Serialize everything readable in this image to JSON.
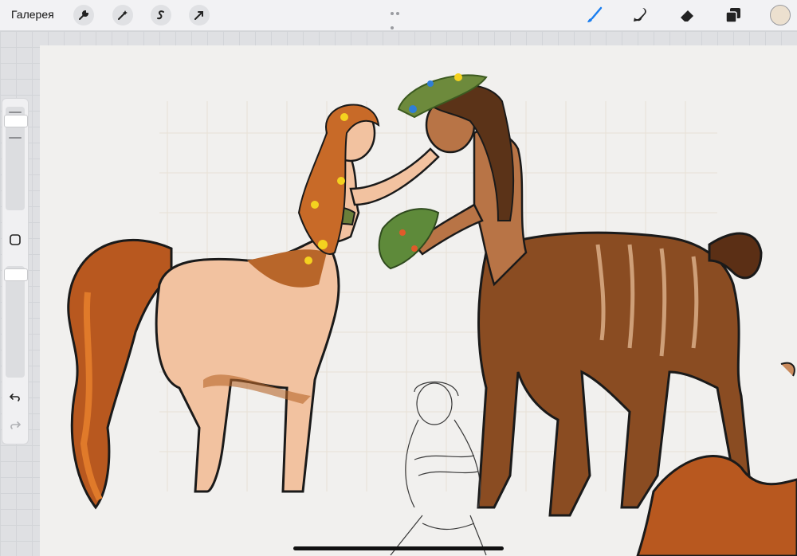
{
  "app": {
    "gallery_label": "Галерея"
  },
  "toolbar": {
    "left_tools": [
      {
        "name": "actions",
        "icon": "wrench-icon"
      },
      {
        "name": "adjustments",
        "icon": "magic-wand-icon"
      },
      {
        "name": "selection",
        "icon": "selection-s-icon"
      },
      {
        "name": "transform",
        "icon": "arrow-cursor-icon"
      }
    ],
    "right_tools": [
      {
        "name": "brush",
        "icon": "brush-icon",
        "active": true
      },
      {
        "name": "smudge",
        "icon": "smudge-icon",
        "active": false
      },
      {
        "name": "eraser",
        "icon": "eraser-icon",
        "active": false
      },
      {
        "name": "layers",
        "icon": "layers-icon",
        "active": false
      }
    ],
    "current_color": "#ece0cf",
    "accent_color": "#1a7ef0"
  },
  "sidebar": {
    "brush_size_icon": "size-slider",
    "modify_button_icon": "square-icon",
    "opacity_icon": "opacity-slider",
    "undo_icon": "undo-icon",
    "redo_icon": "redo-icon"
  }
}
